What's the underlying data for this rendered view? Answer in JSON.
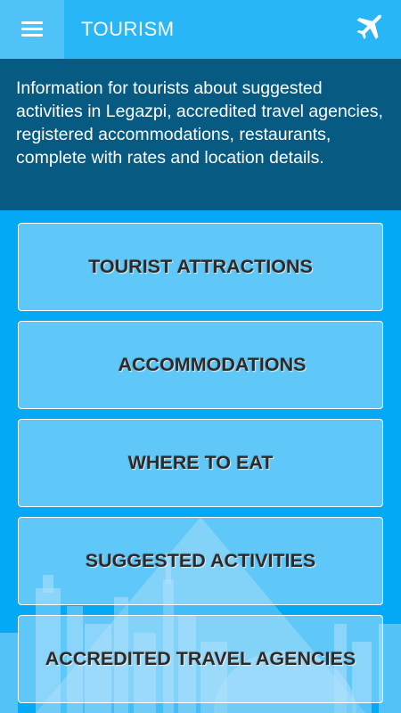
{
  "header": {
    "title": "TOURISM",
    "menu_icon": "hamburger-menu-icon",
    "right_icon": "airplane-icon"
  },
  "intro": {
    "text": "Information for tourists about suggested activities in Legazpi, accredited travel agencies, registered accommodations, restaurants, complete with rates and location details."
  },
  "menu": {
    "items": [
      {
        "label": "TOURIST ATTRACTIONS"
      },
      {
        "label": "ACCOMMODATIONS"
      },
      {
        "label": "WHERE TO EAT"
      },
      {
        "label": "SUGGESTED ACTIVITIES"
      },
      {
        "label": "ACCREDITED TRAVEL AGENCIES"
      }
    ]
  },
  "colors": {
    "background": "#03a9f4",
    "header": "#28b6f6",
    "info_panel": "#075b83"
  }
}
